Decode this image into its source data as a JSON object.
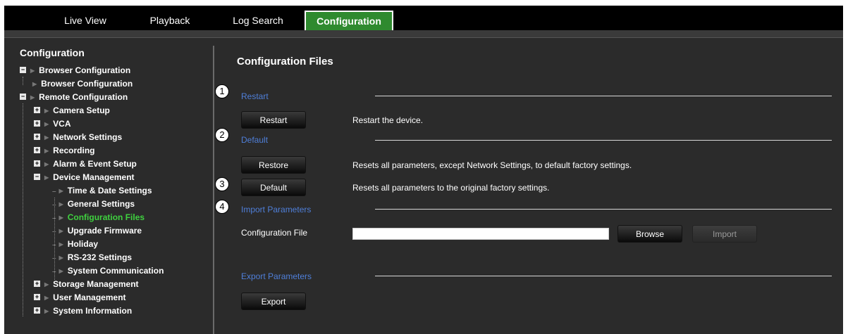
{
  "nav": {
    "tabs": [
      {
        "label": "Live View"
      },
      {
        "label": "Playback"
      },
      {
        "label": "Log Search"
      },
      {
        "label": "Configuration",
        "active": true
      }
    ]
  },
  "sidebar": {
    "title": "Configuration",
    "items": [
      {
        "label": "Browser Configuration"
      },
      {
        "label": "Browser Configuration"
      },
      {
        "label": "Remote Configuration"
      },
      {
        "label": "Camera Setup"
      },
      {
        "label": "VCA"
      },
      {
        "label": "Network Settings"
      },
      {
        "label": "Recording"
      },
      {
        "label": "Alarm & Event Setup"
      },
      {
        "label": "Device Management"
      },
      {
        "label": "Time & Date Settings"
      },
      {
        "label": "General Settings"
      },
      {
        "label": "Configuration Files",
        "selected": true
      },
      {
        "label": "Upgrade Firmware"
      },
      {
        "label": "Holiday"
      },
      {
        "label": "RS-232 Settings"
      },
      {
        "label": "System Communication"
      },
      {
        "label": "Storage Management"
      },
      {
        "label": "User Management"
      },
      {
        "label": "System Information"
      }
    ]
  },
  "main": {
    "title": "Configuration Files",
    "restart": {
      "section": "Restart",
      "button": "Restart",
      "desc": "Restart the device."
    },
    "default": {
      "section": "Default",
      "restore_button": "Restore",
      "restore_desc": "Resets all parameters, except Network Settings, to default factory settings.",
      "default_button": "Default",
      "default_desc": "Resets all parameters to the original factory settings."
    },
    "import": {
      "section": "Import Parameters",
      "file_label": "Configuration File",
      "file_value": "",
      "browse_button": "Browse",
      "import_button": "Import"
    },
    "export": {
      "section": "Export Parameters",
      "button": "Export"
    }
  },
  "callouts": [
    "1",
    "2",
    "3",
    "4"
  ],
  "colors": {
    "active_tab": "#2f8a2f",
    "selected_item": "#3fd13f",
    "section_label": "#4f7fd9",
    "background": "#2b2b2b"
  }
}
